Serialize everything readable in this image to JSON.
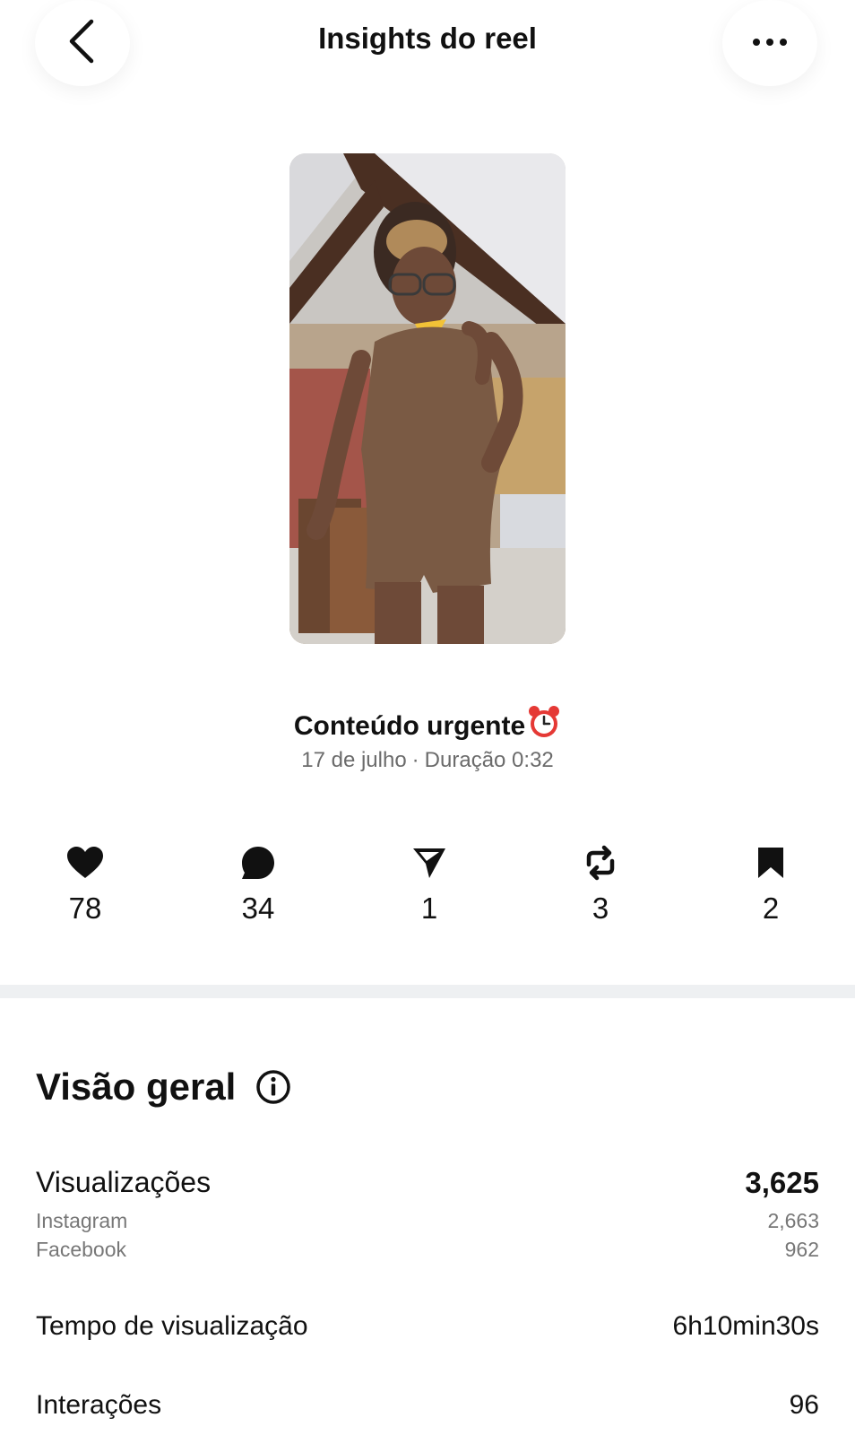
{
  "header": {
    "title": "Insights do reel",
    "back_icon": "chevron-left-icon",
    "more_icon": "more-horizontal-icon"
  },
  "reel": {
    "title": "Conteúdo urgente",
    "emoji_icon": "alarm-clock-icon",
    "date": "17 de julho",
    "separator": "·",
    "duration": "Duração 0:32"
  },
  "stats": [
    {
      "icon": "heart-icon",
      "value": "78"
    },
    {
      "icon": "comment-icon",
      "value": "34"
    },
    {
      "icon": "send-icon",
      "value": "1"
    },
    {
      "icon": "repost-icon",
      "value": "3"
    },
    {
      "icon": "bookmark-icon",
      "value": "2"
    }
  ],
  "overview": {
    "title": "Visão geral",
    "info_icon": "info-icon",
    "views": {
      "label": "Visualizações",
      "value": "3,625",
      "breakdown": [
        {
          "label": "Instagram",
          "value": "2,663"
        },
        {
          "label": "Facebook",
          "value": "962"
        }
      ]
    },
    "watch_time": {
      "label": "Tempo de visualização",
      "value": "6h10min30s"
    },
    "interactions": {
      "label": "Interações",
      "value": "96"
    }
  },
  "colors": {
    "text": "#111111",
    "muted": "#777777",
    "divider": "#eef0f2",
    "alarm": "#e53935"
  }
}
